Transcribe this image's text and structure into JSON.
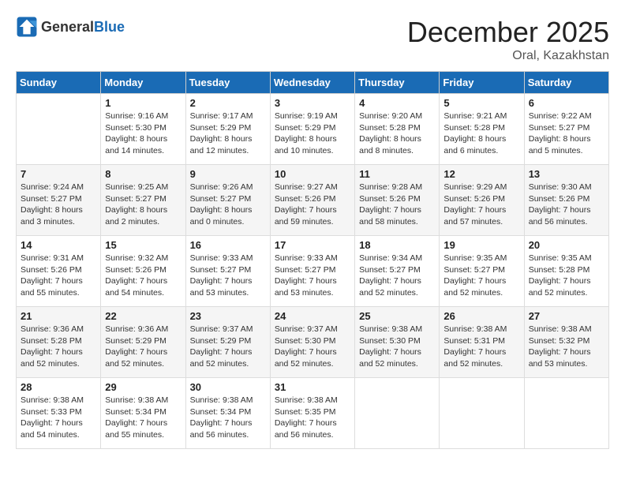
{
  "header": {
    "logo": {
      "general": "General",
      "blue": "Blue"
    },
    "title": "December 2025",
    "location": "Oral, Kazakhstan"
  },
  "columns": [
    "Sunday",
    "Monday",
    "Tuesday",
    "Wednesday",
    "Thursday",
    "Friday",
    "Saturday"
  ],
  "weeks": [
    [
      {
        "day": "",
        "info": ""
      },
      {
        "day": "1",
        "info": "Sunrise: 9:16 AM\nSunset: 5:30 PM\nDaylight: 8 hours\nand 14 minutes."
      },
      {
        "day": "2",
        "info": "Sunrise: 9:17 AM\nSunset: 5:29 PM\nDaylight: 8 hours\nand 12 minutes."
      },
      {
        "day": "3",
        "info": "Sunrise: 9:19 AM\nSunset: 5:29 PM\nDaylight: 8 hours\nand 10 minutes."
      },
      {
        "day": "4",
        "info": "Sunrise: 9:20 AM\nSunset: 5:28 PM\nDaylight: 8 hours\nand 8 minutes."
      },
      {
        "day": "5",
        "info": "Sunrise: 9:21 AM\nSunset: 5:28 PM\nDaylight: 8 hours\nand 6 minutes."
      },
      {
        "day": "6",
        "info": "Sunrise: 9:22 AM\nSunset: 5:27 PM\nDaylight: 8 hours\nand 5 minutes."
      }
    ],
    [
      {
        "day": "7",
        "info": "Sunrise: 9:24 AM\nSunset: 5:27 PM\nDaylight: 8 hours\nand 3 minutes."
      },
      {
        "day": "8",
        "info": "Sunrise: 9:25 AM\nSunset: 5:27 PM\nDaylight: 8 hours\nand 2 minutes."
      },
      {
        "day": "9",
        "info": "Sunrise: 9:26 AM\nSunset: 5:27 PM\nDaylight: 8 hours\nand 0 minutes."
      },
      {
        "day": "10",
        "info": "Sunrise: 9:27 AM\nSunset: 5:26 PM\nDaylight: 7 hours\nand 59 minutes."
      },
      {
        "day": "11",
        "info": "Sunrise: 9:28 AM\nSunset: 5:26 PM\nDaylight: 7 hours\nand 58 minutes."
      },
      {
        "day": "12",
        "info": "Sunrise: 9:29 AM\nSunset: 5:26 PM\nDaylight: 7 hours\nand 57 minutes."
      },
      {
        "day": "13",
        "info": "Sunrise: 9:30 AM\nSunset: 5:26 PM\nDaylight: 7 hours\nand 56 minutes."
      }
    ],
    [
      {
        "day": "14",
        "info": "Sunrise: 9:31 AM\nSunset: 5:26 PM\nDaylight: 7 hours\nand 55 minutes."
      },
      {
        "day": "15",
        "info": "Sunrise: 9:32 AM\nSunset: 5:26 PM\nDaylight: 7 hours\nand 54 minutes."
      },
      {
        "day": "16",
        "info": "Sunrise: 9:33 AM\nSunset: 5:27 PM\nDaylight: 7 hours\nand 53 minutes."
      },
      {
        "day": "17",
        "info": "Sunrise: 9:33 AM\nSunset: 5:27 PM\nDaylight: 7 hours\nand 53 minutes."
      },
      {
        "day": "18",
        "info": "Sunrise: 9:34 AM\nSunset: 5:27 PM\nDaylight: 7 hours\nand 52 minutes."
      },
      {
        "day": "19",
        "info": "Sunrise: 9:35 AM\nSunset: 5:27 PM\nDaylight: 7 hours\nand 52 minutes."
      },
      {
        "day": "20",
        "info": "Sunrise: 9:35 AM\nSunset: 5:28 PM\nDaylight: 7 hours\nand 52 minutes."
      }
    ],
    [
      {
        "day": "21",
        "info": "Sunrise: 9:36 AM\nSunset: 5:28 PM\nDaylight: 7 hours\nand 52 minutes."
      },
      {
        "day": "22",
        "info": "Sunrise: 9:36 AM\nSunset: 5:29 PM\nDaylight: 7 hours\nand 52 minutes."
      },
      {
        "day": "23",
        "info": "Sunrise: 9:37 AM\nSunset: 5:29 PM\nDaylight: 7 hours\nand 52 minutes."
      },
      {
        "day": "24",
        "info": "Sunrise: 9:37 AM\nSunset: 5:30 PM\nDaylight: 7 hours\nand 52 minutes."
      },
      {
        "day": "25",
        "info": "Sunrise: 9:38 AM\nSunset: 5:30 PM\nDaylight: 7 hours\nand 52 minutes."
      },
      {
        "day": "26",
        "info": "Sunrise: 9:38 AM\nSunset: 5:31 PM\nDaylight: 7 hours\nand 52 minutes."
      },
      {
        "day": "27",
        "info": "Sunrise: 9:38 AM\nSunset: 5:32 PM\nDaylight: 7 hours\nand 53 minutes."
      }
    ],
    [
      {
        "day": "28",
        "info": "Sunrise: 9:38 AM\nSunset: 5:33 PM\nDaylight: 7 hours\nand 54 minutes."
      },
      {
        "day": "29",
        "info": "Sunrise: 9:38 AM\nSunset: 5:34 PM\nDaylight: 7 hours\nand 55 minutes."
      },
      {
        "day": "30",
        "info": "Sunrise: 9:38 AM\nSunset: 5:34 PM\nDaylight: 7 hours\nand 56 minutes."
      },
      {
        "day": "31",
        "info": "Sunrise: 9:38 AM\nSunset: 5:35 PM\nDaylight: 7 hours\nand 56 minutes."
      },
      {
        "day": "",
        "info": ""
      },
      {
        "day": "",
        "info": ""
      },
      {
        "day": "",
        "info": ""
      }
    ]
  ]
}
